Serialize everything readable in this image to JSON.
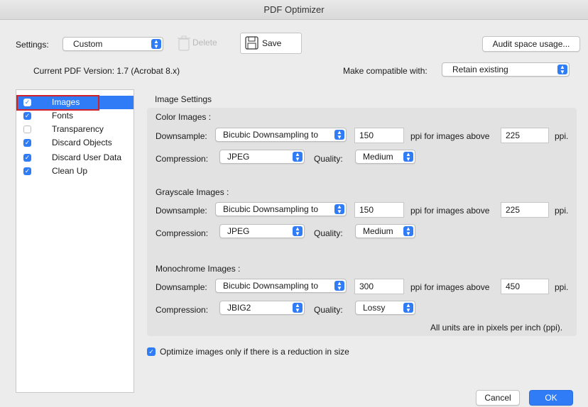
{
  "window": {
    "title": "PDF Optimizer"
  },
  "toolbar": {
    "settings_label": "Settings:",
    "settings_value": "Custom",
    "delete_label": "Delete",
    "save_label": "Save",
    "audit_label": "Audit space usage..."
  },
  "version": {
    "current": "Current PDF Version: 1.7 (Acrobat 8.x)",
    "compat_label": "Make compatible with:",
    "compat_value": "Retain existing"
  },
  "sidebar": {
    "items": [
      {
        "label": "Images",
        "checked": true,
        "selected": true
      },
      {
        "label": "Fonts",
        "checked": true
      },
      {
        "label": "Transparency",
        "checked": false
      },
      {
        "label": "Discard Objects",
        "checked": true
      },
      {
        "label": "Discard User Data",
        "checked": true
      },
      {
        "label": "Clean Up",
        "checked": true
      }
    ]
  },
  "image_settings": {
    "title": "Image Settings",
    "groups": [
      {
        "title": "Color Images :",
        "downsample_label": "Downsample:",
        "downsample_method": "Bicubic Downsampling to",
        "ppi": "150",
        "above_label": "ppi for images above",
        "above_value": "225",
        "unit": "ppi.",
        "compression_label": "Compression:",
        "compression": "JPEG",
        "quality_label": "Quality:",
        "quality": "Medium"
      },
      {
        "title": "Grayscale Images :",
        "downsample_label": "Downsample:",
        "downsample_method": "Bicubic Downsampling to",
        "ppi": "150",
        "above_label": "ppi for images above",
        "above_value": "225",
        "unit": "ppi.",
        "compression_label": "Compression:",
        "compression": "JPEG",
        "quality_label": "Quality:",
        "quality": "Medium"
      },
      {
        "title": "Monochrome Images :",
        "downsample_label": "Downsample:",
        "downsample_method": "Bicubic Downsampling to",
        "ppi": "300",
        "above_label": "ppi for images above",
        "above_value": "450",
        "unit": "ppi.",
        "compression_label": "Compression:",
        "compression": "JBIG2",
        "quality_label": "Quality:",
        "quality": "Lossy"
      }
    ],
    "units_note": "All units are in pixels per inch (ppi)."
  },
  "optimize_only": {
    "label": "Optimize images only if there is a reduction in size",
    "checked": true
  },
  "footer": {
    "cancel_label": "Cancel",
    "ok_label": "OK"
  },
  "colors": {
    "accent": "#2f7cf6",
    "highlight_border": "#d0202a"
  }
}
